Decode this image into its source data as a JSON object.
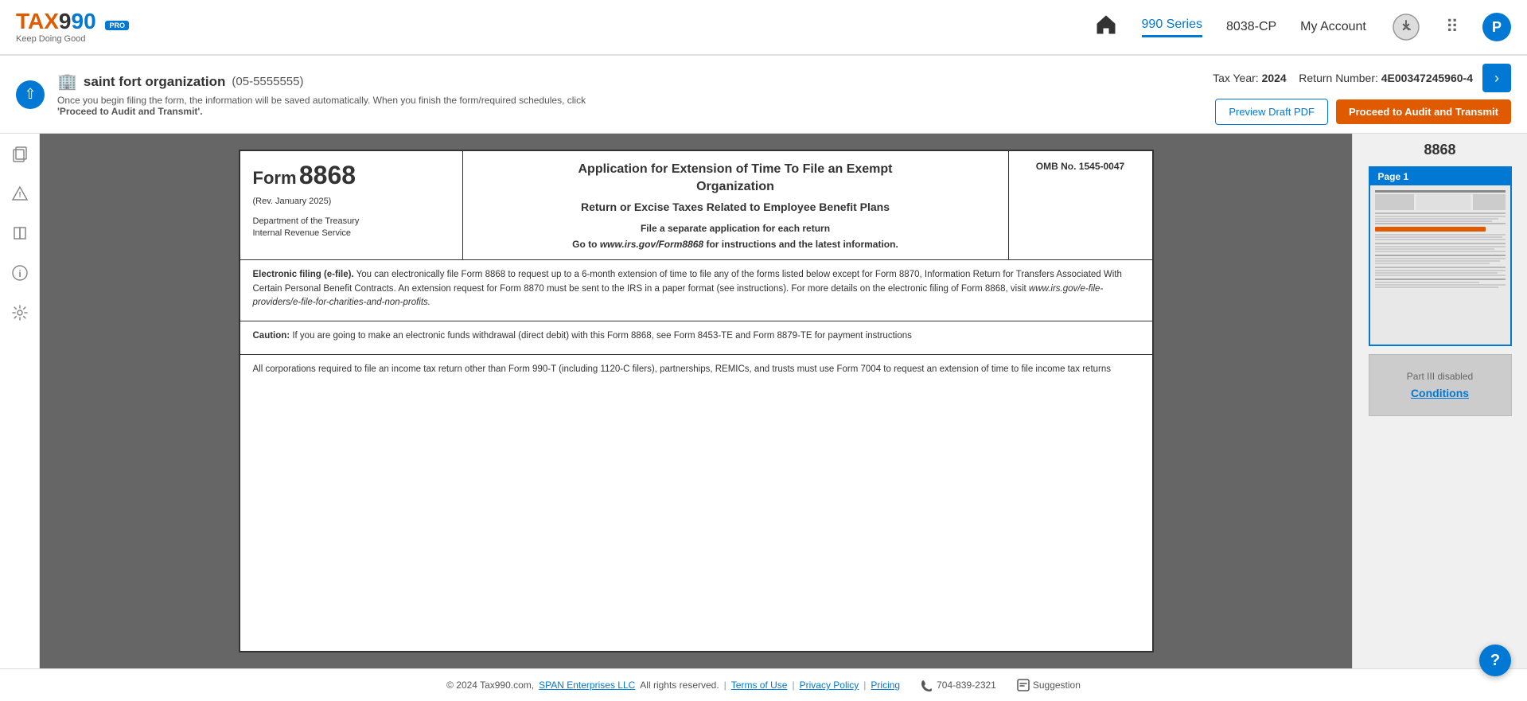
{
  "header": {
    "logo": {
      "brand": "TAX990",
      "badge": "PRO",
      "tagline": "Keep Doing Good"
    },
    "nav": {
      "home_label": "Home",
      "series_label": "990 Series",
      "form_label": "8038-CP",
      "account_label": "My Account"
    }
  },
  "subheader": {
    "org_name": "saint fort organization",
    "org_ein": "(05-5555555)",
    "notice": "Once you begin filing the form, the information will be saved automatically. When you finish the form/required schedules, click ",
    "notice_bold": "'Proceed to Audit and Transmit'.",
    "tax_year_label": "Tax Year:",
    "tax_year_value": "2024",
    "return_label": "Return Number:",
    "return_number": "4E00347245960-4",
    "btn_preview": "Preview Draft PDF",
    "btn_proceed": "Proceed to Audit and Transmit"
  },
  "form": {
    "form_label": "Form",
    "form_number": "8868",
    "rev": "(Rev. January 2025)",
    "dept1": "Department of the Treasury",
    "dept2": "Internal Revenue Service",
    "title_line1": "Application for Extension of Time To File an Exempt",
    "title_line2": "Organization",
    "title_line3": "Return or Excise Taxes Related to Employee Benefit Plans",
    "sep_label": "File a separate application for each return",
    "url_label": "Go to",
    "url_text": "www.irs.gov/Form8868",
    "url_suffix": "for instructions and the latest information.",
    "omb": "OMB No. 1545-0047",
    "efile_title": "Electronic filing (e-file).",
    "efile_text": "You can electronically file Form 8868 to request up to a 6-month extension of time to file any of the forms listed below except for Form 8870, Information Return for Transfers Associated With Certain Personal Benefit Contracts. An extension request for Form 8870 must be sent to the IRS in a paper format (see instructions). For more details on the electronic filing of Form 8868, visit",
    "efile_url": "www.irs.gov/e-file-providers/e-file-for-charities-and-non-profits.",
    "caution_title": "Caution:",
    "caution_text": "If you are going to make an electronic funds withdrawal (direct debit) with this Form 8868, see Form 8453-TE and Form 8879-TE for payment instructions",
    "corporations_text": "All corporations required to file an income tax return other than Form 990-T (including 1120-C filers), partnerships, REMICs, and trusts must use Form 7004 to request an extension of time to file income tax returns"
  },
  "right_panel": {
    "form_label": "8868",
    "page_label": "Page 1",
    "part_disabled_label": "Part III disabled",
    "conditions_label": "Conditions"
  },
  "footer": {
    "copyright": "© 2024 Tax990.com,",
    "span_link": "SPAN Enterprises LLC",
    "rights": "All rights reserved.",
    "terms_link": "Terms of Use",
    "privacy_link": "Privacy Policy",
    "pricing_link": "Pricing",
    "phone": "704-839-2321",
    "suggestion_label": "Suggestion"
  },
  "help": {
    "label": "?"
  }
}
